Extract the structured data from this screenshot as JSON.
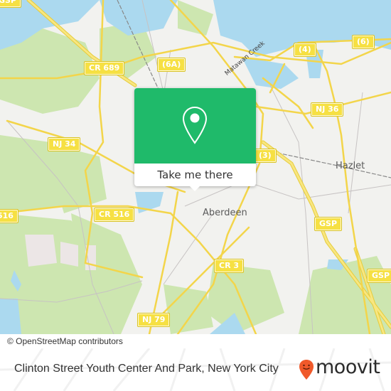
{
  "map": {
    "labels": {
      "places": [
        "Aberdeen",
        "Hazlet"
      ],
      "water": [
        "Matawan Creek"
      ],
      "shields": [
        "GSP",
        "CR 689",
        "(6A)",
        "(4)",
        "(6)",
        "NJ 36",
        "NJ 34",
        "(3)",
        "CR 516",
        "516",
        "GSP",
        "CR 3",
        "GSP",
        "NJ 79"
      ]
    },
    "colors": {
      "land": "#f2f2ef",
      "water": "#abd9ef",
      "park": "#cde6b0",
      "road": "#f6e043",
      "accent": "#1fba6a"
    }
  },
  "popup": {
    "icon": "location-pin-icon",
    "button_label": "Take me there"
  },
  "attribution": "© OpenStreetMap contributors",
  "footer": {
    "title": "Clinton Street Youth Center And Park, New York City",
    "brand": "moovit",
    "brand_icon": "moovit-smiley-pin-icon",
    "brand_color": "#f0592a"
  }
}
